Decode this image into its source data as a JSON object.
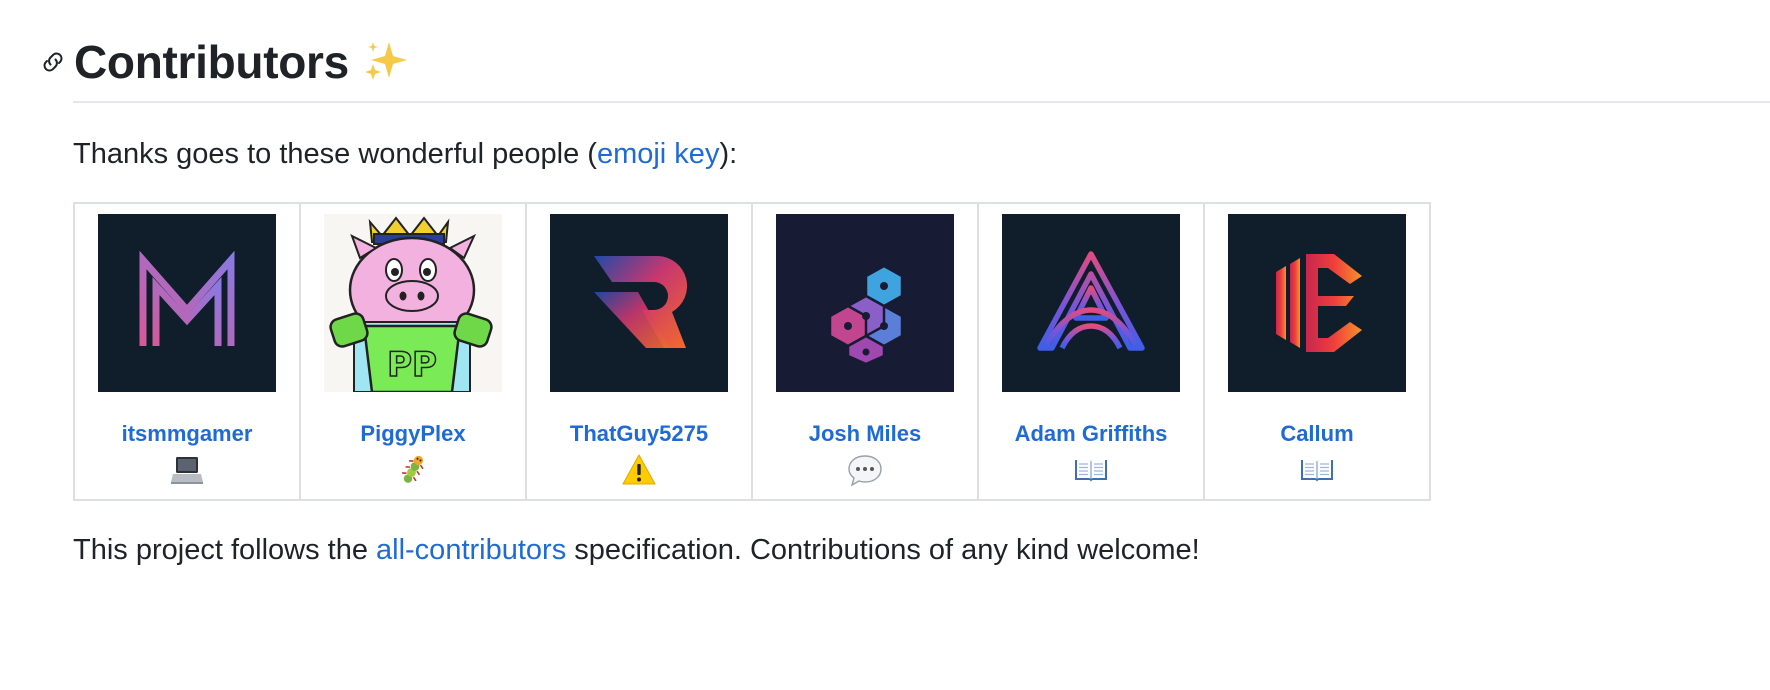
{
  "heading": {
    "title": "Contributors",
    "sparkle_icon": "sparkles-icon"
  },
  "intro": {
    "prefix": "Thanks goes to these wonderful people (",
    "link": "emoji key",
    "suffix": "):"
  },
  "contributors": [
    {
      "name": "itsmmgamer",
      "contribution_icon": "laptop-icon"
    },
    {
      "name": "PiggyPlex",
      "contribution_icon": "bug-icon"
    },
    {
      "name": "ThatGuy5275",
      "contribution_icon": "warning-icon"
    },
    {
      "name": "Josh Miles",
      "contribution_icon": "speech-bubble-icon"
    },
    {
      "name": "Adam Griffiths",
      "contribution_icon": "book-icon"
    },
    {
      "name": "Callum",
      "contribution_icon": "book-icon"
    }
  ],
  "footer": {
    "prefix": "This project follows the ",
    "link": "all-contributors",
    "suffix": " specification. Contributions of any kind welcome!"
  },
  "colors": {
    "link": "#1f6bd6",
    "text": "#1f2328",
    "avatar_dark": "#0f1e2a",
    "border": "#dcdfe3"
  }
}
